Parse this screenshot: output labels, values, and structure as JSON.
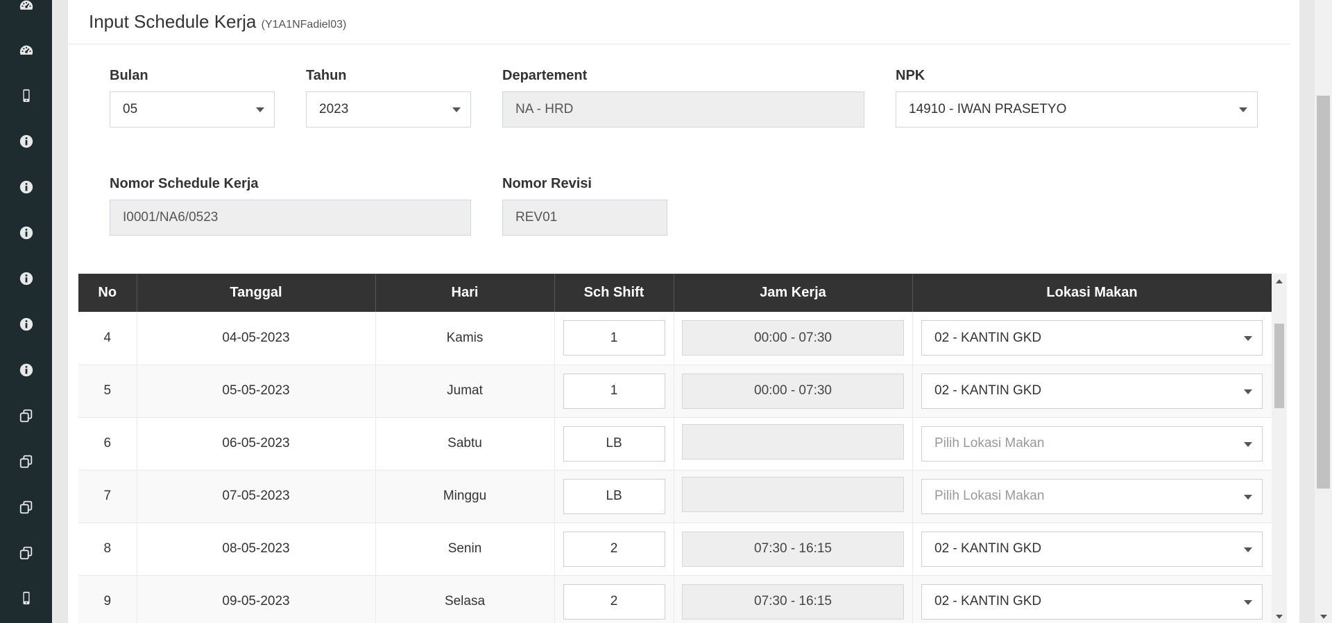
{
  "sidebar": {
    "icons": [
      "dashboard-icon",
      "dashboard-icon",
      "mobile-icon",
      "info-icon",
      "info-icon",
      "info-icon",
      "info-icon",
      "info-icon",
      "info-icon",
      "copy-icon",
      "copy-icon",
      "copy-icon",
      "copy-icon",
      "mobile-icon"
    ]
  },
  "header": {
    "title": "Input Schedule Kerja",
    "subtitle": "(Y1A1NFadiel03)"
  },
  "form": {
    "bulan_label": "Bulan",
    "bulan_value": "05",
    "tahun_label": "Tahun",
    "tahun_value": "2023",
    "departement_label": "Departement",
    "departement_value": "NA - HRD",
    "npk_label": "NPK",
    "npk_value": "14910 - IWAN PRASETYO",
    "nomor_schedule_label": "Nomor Schedule Kerja",
    "nomor_schedule_value": "I0001/NA6/0523",
    "nomor_revisi_label": "Nomor Revisi",
    "nomor_revisi_value": "REV01"
  },
  "table": {
    "headers": [
      "No",
      "Tanggal",
      "Hari",
      "Sch Shift",
      "Jam Kerja",
      "Lokasi Makan"
    ],
    "lokasi_placeholder": "Pilih Lokasi Makan",
    "rows": [
      {
        "no": "4",
        "tanggal": "04-05-2023",
        "hari": "Kamis",
        "shift": "1",
        "jam": "00:00 - 07:30",
        "lokasi": "02 - KANTIN GKD"
      },
      {
        "no": "5",
        "tanggal": "05-05-2023",
        "hari": "Jumat",
        "shift": "1",
        "jam": "00:00 - 07:30",
        "lokasi": "02 - KANTIN GKD"
      },
      {
        "no": "6",
        "tanggal": "06-05-2023",
        "hari": "Sabtu",
        "shift": "LB",
        "jam": "",
        "lokasi": ""
      },
      {
        "no": "7",
        "tanggal": "07-05-2023",
        "hari": "Minggu",
        "shift": "LB",
        "jam": "",
        "lokasi": ""
      },
      {
        "no": "8",
        "tanggal": "08-05-2023",
        "hari": "Senin",
        "shift": "2",
        "jam": "07:30 - 16:15",
        "lokasi": "02 - KANTIN GKD"
      },
      {
        "no": "9",
        "tanggal": "09-05-2023",
        "hari": "Selasa",
        "shift": "2",
        "jam": "07:30 - 16:15",
        "lokasi": "02 - KANTIN GKD"
      }
    ]
  },
  "colors": {
    "sidebar_bg": "#1e2b2f",
    "table_header_bg": "#333333",
    "disabled_bg": "#eeeeee"
  }
}
